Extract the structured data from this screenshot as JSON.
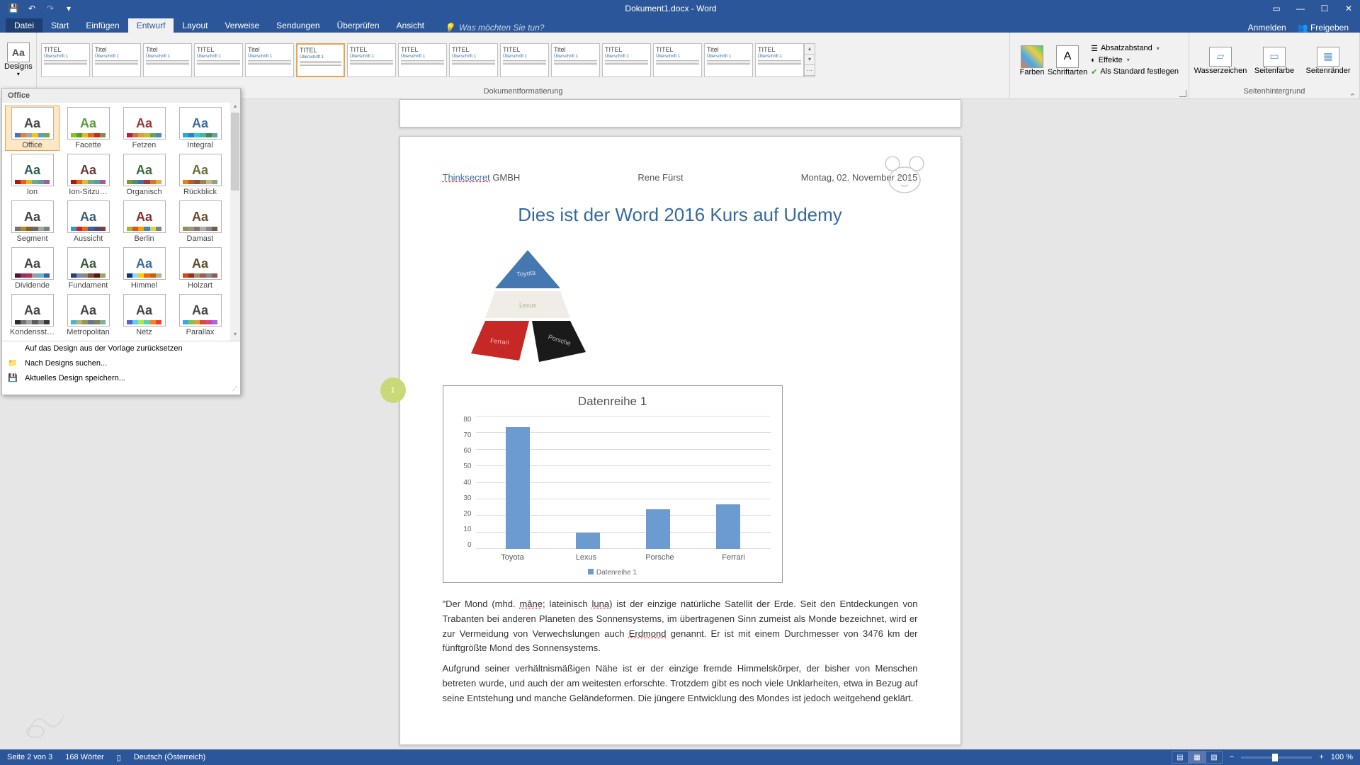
{
  "titlebar": {
    "title": "Dokument1.docx - Word"
  },
  "tabs": {
    "file": "Datei",
    "items": [
      "Start",
      "Einfügen",
      "Entwurf",
      "Layout",
      "Verweise",
      "Sendungen",
      "Überprüfen",
      "Ansicht"
    ],
    "active": "Entwurf",
    "tellme_placeholder": "Was möchten Sie tun?",
    "signin": "Anmelden",
    "share": "Freigeben"
  },
  "ribbon": {
    "designs_label": "Designs",
    "format_group": "Dokumentformatierung",
    "format_items": [
      {
        "title": "TITEL"
      },
      {
        "title": "Titel"
      },
      {
        "title": "Titel"
      },
      {
        "title": "TITEL"
      },
      {
        "title": "Titel"
      },
      {
        "title": "TITEL"
      },
      {
        "title": "TITEL"
      },
      {
        "title": "TITEL"
      },
      {
        "title": "TITEL"
      },
      {
        "title": "TITEL"
      },
      {
        "title": "Titel"
      },
      {
        "title": "TITEL"
      },
      {
        "title": "TITEL"
      },
      {
        "title": "Titel"
      },
      {
        "title": "TITEL"
      }
    ],
    "colors": "Farben",
    "fonts": "Schriftarten",
    "para_spacing": "Absatzabstand",
    "effects": "Effekte",
    "set_default": "Als Standard festlegen",
    "watermark": "Wasserzeichen",
    "page_color": "Seitenfarbe",
    "page_borders": "Seitenränder",
    "page_bg_group": "Seitenhintergrund"
  },
  "themes_dropdown": {
    "header": "Office",
    "items": [
      {
        "name": "Office",
        "aa_color": "#444",
        "sw": [
          "#4472c4",
          "#ed7d31",
          "#a5a5a5",
          "#ffc000",
          "#5b9bd5",
          "#70ad47"
        ]
      },
      {
        "name": "Facette",
        "aa_color": "#5b9b3e",
        "sw": [
          "#90c226",
          "#54a021",
          "#e6b91e",
          "#e76618",
          "#c42f1a",
          "#918655"
        ]
      },
      {
        "name": "Fetzen",
        "aa_color": "#9b3b3b",
        "sw": [
          "#b71e42",
          "#de6c36",
          "#e09b3a",
          "#c5c12c",
          "#6aa55f",
          "#4e8db0"
        ]
      },
      {
        "name": "Integral",
        "aa_color": "#3b6b9b",
        "sw": [
          "#1cade4",
          "#2683c6",
          "#27ced7",
          "#42ba97",
          "#3e8853",
          "#62a39f"
        ]
      },
      {
        "name": "Ion",
        "aa_color": "#2d5c5c",
        "sw": [
          "#b01513",
          "#ea6312",
          "#e6b729",
          "#6aac90",
          "#5f9c9d",
          "#9e5e9b"
        ]
      },
      {
        "name": "Ion-Sitzu…",
        "aa_color": "#6b3b3b",
        "sw": [
          "#b01513",
          "#ea6312",
          "#e6b729",
          "#6aac90",
          "#5f9c9d",
          "#9e5e9b"
        ]
      },
      {
        "name": "Organisch",
        "aa_color": "#3b6b3b",
        "sw": [
          "#83992a",
          "#3c9770",
          "#44709d",
          "#a23c33",
          "#d97828",
          "#deb340"
        ]
      },
      {
        "name": "Rückblick",
        "aa_color": "#6b6b3b",
        "sw": [
          "#e48312",
          "#bd582c",
          "#865640",
          "#9b8357",
          "#c2bc80",
          "#94a088"
        ]
      },
      {
        "name": "Segment",
        "aa_color": "#444",
        "sw": [
          "#747474",
          "#b88726",
          "#8a5e2b",
          "#6b695f",
          "#a5a5a5",
          "#7f7f7f"
        ]
      },
      {
        "name": "Aussicht",
        "aa_color": "#3b5b7b",
        "sw": [
          "#2da2bf",
          "#da1f28",
          "#eb641b",
          "#39639d",
          "#474b78",
          "#7d3c4a"
        ]
      },
      {
        "name": "Berlin",
        "aa_color": "#8b2b2b",
        "sw": [
          "#a6b727",
          "#df5327",
          "#fe9e00",
          "#418ab3",
          "#d7d447",
          "#818183"
        ]
      },
      {
        "name": "Damast",
        "aa_color": "#6b4b2b",
        "sw": [
          "#9e8e5c",
          "#a09781",
          "#85776d",
          "#aeafa9",
          "#8d878b",
          "#6b6149"
        ]
      },
      {
        "name": "Dividende",
        "aa_color": "#444",
        "sw": [
          "#4d1434",
          "#903163",
          "#b2324b",
          "#969fa7",
          "#66b1ce",
          "#40619d"
        ]
      },
      {
        "name": "Fundament",
        "aa_color": "#3b5b3b",
        "sw": [
          "#294171",
          "#748cbc",
          "#8e887c",
          "#834736",
          "#5a1705",
          "#a0a16a"
        ]
      },
      {
        "name": "Himmel",
        "aa_color": "#3b6b9b",
        "sw": [
          "#073779",
          "#8fd9fb",
          "#ffcc00",
          "#eb6615",
          "#c76402",
          "#b4b392"
        ]
      },
      {
        "name": "Holzart",
        "aa_color": "#5b4b2b",
        "sw": [
          "#d34817",
          "#9b2d1f",
          "#a28e6a",
          "#956251",
          "#918485",
          "#855d5d"
        ]
      },
      {
        "name": "Kondensst…",
        "aa_color": "#444",
        "sw": [
          "#2c2c2c",
          "#747474",
          "#a1a1a1",
          "#5c5c5c",
          "#8a8a8a",
          "#383838"
        ]
      },
      {
        "name": "Metropolitan",
        "aa_color": "#444",
        "sw": [
          "#50b4c8",
          "#a8b97f",
          "#9b9256",
          "#657689",
          "#7a855d",
          "#84ac9d"
        ]
      },
      {
        "name": "Netz",
        "aa_color": "#444",
        "sw": [
          "#4e67c8",
          "#5eccf3",
          "#a7ea52",
          "#5dceaf",
          "#ff8021",
          "#f14124"
        ]
      },
      {
        "name": "Parallax",
        "aa_color": "#444",
        "sw": [
          "#30acec",
          "#80c34f",
          "#e29d3e",
          "#d64a3b",
          "#d64787",
          "#a666e1"
        ]
      }
    ],
    "reset": "Auf das Design aus der Vorlage zurücksetzen",
    "search": "Nach Designs suchen...",
    "save": "Aktuelles Design speichern..."
  },
  "document": {
    "header": {
      "company_link": "Thinksecret",
      "company_suffix": " GMBH",
      "author": "Rene Fürst",
      "date": "Montag, 02. November 2015"
    },
    "page_badge": "1",
    "title": "Dies ist der Word 2016 Kurs auf Udemy",
    "pyramid_labels": [
      "Toyota",
      "Lexus",
      "Ferrari",
      "Porsche"
    ],
    "body_p1_pre": "\"Der Mond (mhd. ",
    "body_p1_u1": "mâne",
    "body_p1_mid1": "; lateinisch ",
    "body_p1_u2": "luna",
    "body_p1_mid2": ") ist der einzige natürliche Satellit der Erde. Seit den Entdeckungen von Trabanten bei anderen Planeten des Sonnensystems, im übertragenen Sinn zumeist als Monde bezeichnet, wird er zur Vermeidung von Verwechslungen auch ",
    "body_p1_u3": "Erdmond",
    "body_p1_post": " genannt. Er ist mit einem Durchmesser von 3476 km der fünftgrößte Mond des Sonnensystems.",
    "body_p2": "Aufgrund seiner verhältnismäßigen Nähe ist er der einzige fremde Himmelskörper, der bisher von Menschen betreten wurde, und auch der am weitesten erforschte. Trotzdem gibt es noch viele Unklarheiten, etwa in Bezug auf seine Entstehung und manche Geländeformen. Die jüngere Entwicklung des Mondes ist jedoch weitgehend geklärt."
  },
  "chart_data": {
    "type": "bar",
    "title": "Datenreihe 1",
    "categories": [
      "Toyota",
      "Lexus",
      "Porsche",
      "Ferrari"
    ],
    "values": [
      73,
      10,
      24,
      27
    ],
    "ylim": [
      0,
      80
    ],
    "yticks": [
      0,
      10,
      20,
      30,
      40,
      50,
      60,
      70,
      80
    ],
    "legend": "Datenreihe 1"
  },
  "statusbar": {
    "page": "Seite 2 von 3",
    "words": "168 Wörter",
    "lang": "Deutsch (Österreich)",
    "zoom": "100 %"
  }
}
